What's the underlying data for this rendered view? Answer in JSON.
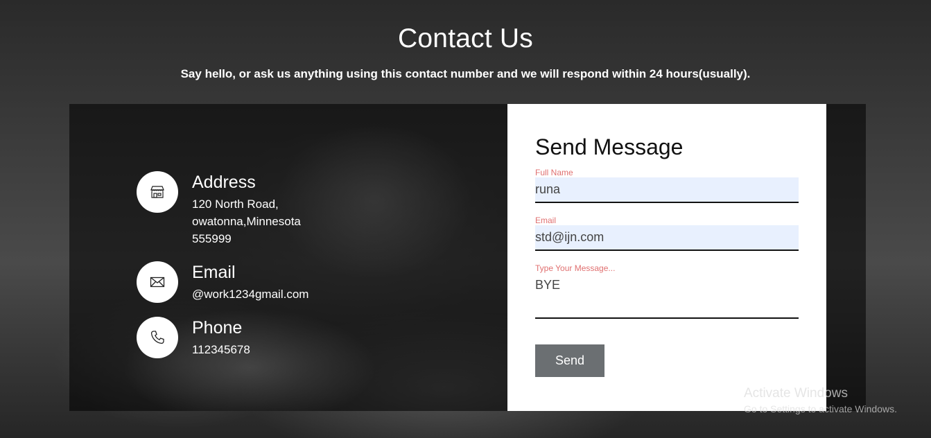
{
  "header": {
    "title": "Contact Us",
    "subtitle": "Say hello, or ask us anything using this contact number and we will respond within 24 hours(usually)."
  },
  "contact_info": {
    "address": {
      "icon": "store-icon",
      "title": "Address",
      "lines": [
        "120 North Road,",
        "owatonna,Minnesota",
        "555999"
      ]
    },
    "email": {
      "icon": "envelope-icon",
      "title": "Email",
      "value": "@work1234gmail.com"
    },
    "phone": {
      "icon": "phone-icon",
      "title": "Phone",
      "value": "112345678"
    }
  },
  "form": {
    "title": "Send Message",
    "full_name": {
      "label": "Full Name",
      "value": "runa"
    },
    "email": {
      "label": "Email",
      "value": "std@ijn.com"
    },
    "message": {
      "label": "Type Your Message...",
      "value": "BYE"
    },
    "send_label": "Send"
  },
  "watermark": {
    "title": "Activate Windows",
    "subtitle": "Go to Settings to activate Windows."
  },
  "colors": {
    "label_accent": "#e07070",
    "autofill_bg": "#e8f0fe",
    "button_bg": "#6b6f72"
  }
}
